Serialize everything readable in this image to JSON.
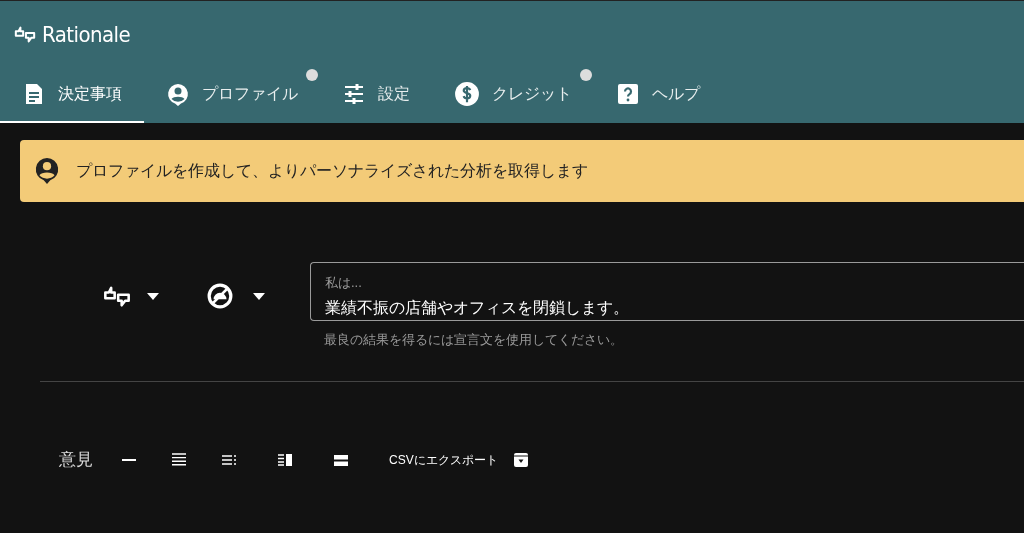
{
  "app": {
    "name": "Rationale"
  },
  "tabs": [
    {
      "label": "決定事項",
      "selected": true,
      "badge": false
    },
    {
      "label": "プロファイル",
      "selected": false,
      "badge": true
    },
    {
      "label": "設定",
      "selected": false,
      "badge": false
    },
    {
      "label": "クレジット",
      "selected": false,
      "badge": true
    },
    {
      "label": "ヘルプ",
      "selected": false,
      "badge": false
    }
  ],
  "banner": {
    "text": "プロファイルを作成して、よりパーソナライズされた分析を取得します"
  },
  "decision_field": {
    "label": "私は...",
    "value": "業績不振の店舗やオフィスを閉鎖します。",
    "helper": "最良の結果を得るには宣言文を使用してください。"
  },
  "toolbar": {
    "label": "意見",
    "export": "CSVにエクスポート"
  }
}
